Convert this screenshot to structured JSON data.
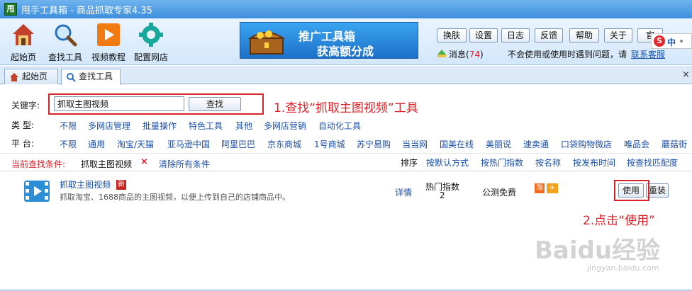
{
  "window": {
    "logo_char": "甩",
    "title": "甩手工具箱 - 商品抓取专家4.35"
  },
  "toolbar": {
    "buttons": [
      {
        "label": "起始页",
        "icon": "home-icon"
      },
      {
        "label": "查找工具",
        "icon": "magnifier-icon"
      },
      {
        "label": "视频教程",
        "icon": "play-icon"
      },
      {
        "label": "配置网店",
        "icon": "gear-icon"
      }
    ],
    "banner": {
      "line1": "推广工具箱",
      "line2": "获高额分成"
    },
    "small_buttons": [
      "换肤",
      "设置",
      "日志",
      "反馈",
      "帮助",
      "关于",
      "官"
    ],
    "messages_label": "消息(",
    "messages_count": "74",
    "messages_close": ")",
    "help_text": "不会使用或使用时遇到问题，请",
    "service_link": "联系客服"
  },
  "ime": {
    "logo": "S",
    "mode": "中"
  },
  "tabs": [
    {
      "label": "起始页",
      "icon": "home-icon",
      "active": false
    },
    {
      "label": "查找工具",
      "icon": "magnifier-icon",
      "active": true
    }
  ],
  "search": {
    "label": "关键字:",
    "value": "抓取主图视频",
    "button": "查找",
    "annotation": "1.查找“抓取主图视频”工具"
  },
  "filters": {
    "type_label": "类  型:",
    "types": [
      "不限",
      "多网店管理",
      "批量操作",
      "特色工具",
      "其他",
      "多网店营销",
      "自动化工具"
    ],
    "platform_label": "平  台:",
    "platforms": [
      "不限",
      "通用",
      "淘宝/天猫",
      "亚马逊中国",
      "阿里巴巴",
      "京东商城",
      "1号商城",
      "苏宁易购",
      "当当网",
      "国美在线",
      "美丽说",
      "速卖通",
      "口袋购物微店",
      "唯品会",
      "蘑菇街"
    ]
  },
  "conditions": {
    "label": "当前查找条件:",
    "value": "抓取主图视频",
    "remove": "×",
    "clear": "清除所有条件",
    "sort_label": "排序",
    "sort_options": [
      "按默认方式",
      "按热门指数",
      "按名称",
      "按发布时间",
      "按查找匹配度"
    ]
  },
  "result": {
    "name": "抓取主图视频",
    "badge": "新",
    "description": "抓取淘宝、1688商品的主图视频，以便上传到自己的店铺商品中。",
    "details": "详情",
    "hot_label": "热门指数",
    "hot_value": "2",
    "license": "公测免费",
    "platform_icon_1": "淘",
    "use_button": "使用",
    "reinstall_button": "重装",
    "annotation": "2.点击“使用”"
  },
  "watermark": {
    "text": "Baidu经验",
    "url": "jingyan.baidu.com"
  },
  "colors": {
    "accent_red": "#d9232b",
    "link_blue": "#1a4fa8",
    "title_blue": "#3d8fdc"
  }
}
